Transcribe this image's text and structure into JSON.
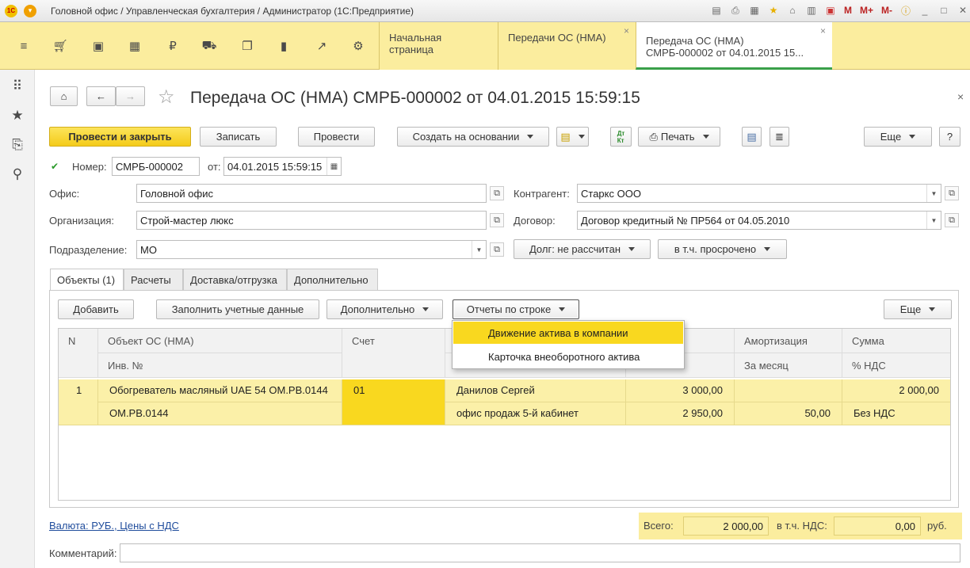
{
  "window": {
    "title": "Головной офис / Управленческая бухгалтерия / Администратор  (1С:Предприятие)",
    "logo": "1С"
  },
  "titlebar_icons": {
    "m": "M",
    "mplus": "M+",
    "mminus": "M-"
  },
  "topbar": {
    "sections": [
      "menu-icon",
      "cart-icon",
      "bag-icon",
      "grid-icon",
      "ruble-icon",
      "truck-icon",
      "copy-icon",
      "bar-chart-icon",
      "trend-icon",
      "gear-icon"
    ],
    "tabs": [
      {
        "label": "Начальная страница"
      },
      {
        "label": "Передачи ОС (НМА)"
      },
      {
        "label": "Передача ОС (НМА)",
        "label2": "СМРБ-000002 от 04.01.2015 15..."
      }
    ]
  },
  "form": {
    "title": "Передача ОС (НМА) СМРБ-000002 от 04.01.2015 15:59:15",
    "toolbar": {
      "post_close": "Провести и закрыть",
      "save": "Записать",
      "post": "Провести",
      "create_based": "Создать на основании",
      "print": "Печать",
      "more": "Еще",
      "help": "?"
    },
    "number_label": "Номер:",
    "number": "СМРБ-000002",
    "date_label": "от:",
    "date": "04.01.2015 15:59:15",
    "office_label": "Офис:",
    "office": "Головной офис",
    "org_label": "Организация:",
    "org": "Строй-мастер люкс",
    "dept_label": "Подразделение:",
    "dept": "МО",
    "counterparty_label": "Контрагент:",
    "counterparty": "Старкс ООО",
    "contract_label": "Договор:",
    "contract": "Договор кредитный № ПР564 от 04.05.2010",
    "debt": "Долг: не рассчитан",
    "overdue": "в т.ч. просрочено"
  },
  "tabs": [
    "Объекты (1)",
    "Расчеты",
    "Доставка/отгрузка",
    "Дополнительно"
  ],
  "objects_toolbar": {
    "add": "Добавить",
    "fill": "Заполнить учетные данные",
    "extra": "Дополнительно",
    "reports": "Отчеты по строке",
    "more": "Еще"
  },
  "grid": {
    "headers": {
      "n": "N",
      "object": "Объект ОС (НМА)",
      "inv": "Инв. №",
      "account": "Счет",
      "mol_top": "",
      "mol_bottom": "",
      "cost_top": "ь",
      "cost_bottom": "ая",
      "amort": "Амортизация",
      "amort_month": "За месяц",
      "sum": "Сумма",
      "vat": "% НДС"
    },
    "rows": [
      {
        "n": "1",
        "object": "Обогреватель масляный UAE 54 ОМ.РВ.0144",
        "inv": "ОМ.РВ.0144",
        "account": "01",
        "mol": "Данилов Сергей",
        "location": "офис продаж 5-й кабинет",
        "cost": "3 000,00",
        "residual": "2 950,00",
        "amort": "",
        "amort_month": "50,00",
        "sum": "2 000,00",
        "vat": "Без НДС"
      }
    ]
  },
  "popup": {
    "items": [
      "Движение актива в компании",
      "Карточка внеоборотного актива"
    ]
  },
  "footer": {
    "currency": "Валюта: РУБ., Цены с НДС",
    "total_label": "Всего:",
    "total": "2 000,00",
    "vat_label": "в т.ч. НДС:",
    "vat": "0,00",
    "currency_unit": "руб.",
    "comment_label": "Комментарий:",
    "comment": ""
  }
}
